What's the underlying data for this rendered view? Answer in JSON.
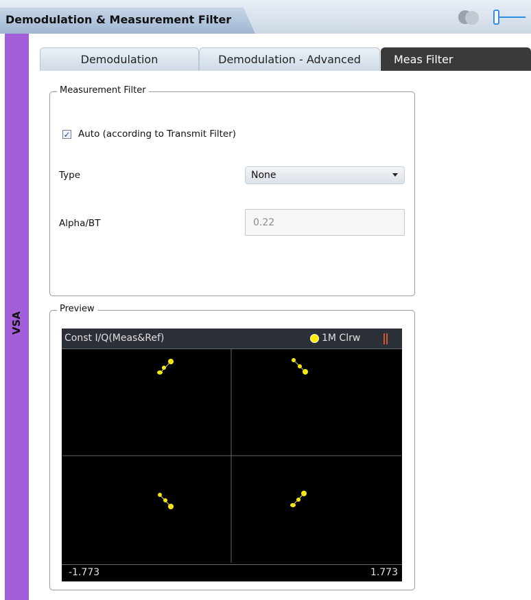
{
  "window": {
    "title": "Demodulation & Measurement Filter",
    "icons": [
      "circles-icon",
      "slider-icon"
    ]
  },
  "sidebar": {
    "label": "VSA",
    "color": "#a35fd9"
  },
  "tabs": [
    {
      "label": "Demodulation",
      "active": false
    },
    {
      "label": "Demodulation - Advanced",
      "active": false
    },
    {
      "label": "Meas Filter",
      "active": true
    }
  ],
  "measurement_filter": {
    "legend": "Measurement Filter",
    "auto": {
      "label": "Auto (according to Transmit Filter)",
      "checked": true
    },
    "type": {
      "label": "Type",
      "value": "None"
    },
    "alpha": {
      "label": "Alpha/BT",
      "value": "0.22"
    }
  },
  "preview": {
    "legend": "Preview",
    "display": {
      "title": "Const I/Q(Meas&Ref)",
      "trace_label": "1M Clrw",
      "trace_color": "#ffee00",
      "axis_min": "-1.773",
      "axis_max": "1.773"
    }
  }
}
